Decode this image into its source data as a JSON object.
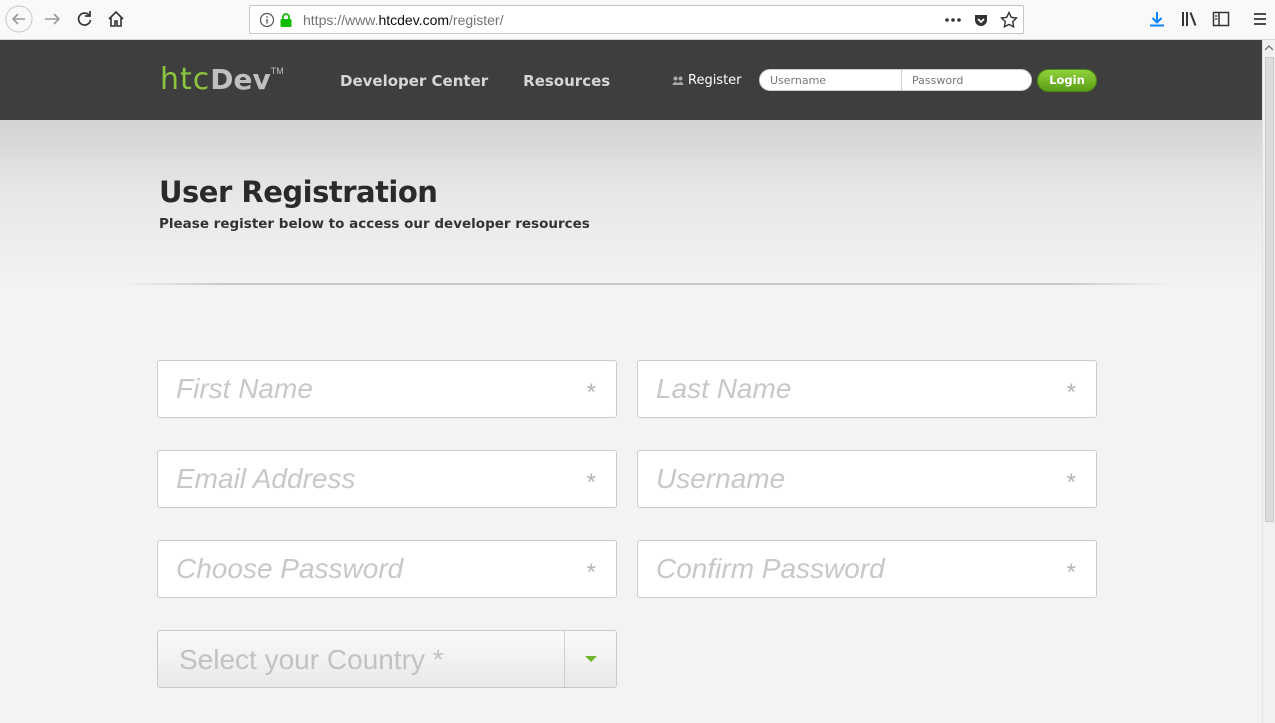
{
  "browser": {
    "url_prefix": "https://www.",
    "url_host": "htcdev.com",
    "url_path": "/register/",
    "icons": [
      "back-icon",
      "forward-icon",
      "reload-icon",
      "home-icon",
      "info-icon",
      "lock-icon",
      "more-icon",
      "pocket-icon",
      "bookmark-star-icon",
      "download-icon",
      "library-icon",
      "sidebar-icon",
      "menu-icon"
    ]
  },
  "header": {
    "logo_htc": "htc",
    "logo_dev": "Dev",
    "logo_tm": "TM",
    "nav": [
      "Developer Center",
      "Resources"
    ],
    "register_label": "Register",
    "username_placeholder": "Username",
    "password_placeholder": "Password",
    "login_label": "Login",
    "bg_color": "#3e3e3e",
    "accent_color": "#8cc43f"
  },
  "hero": {
    "title": "User Registration",
    "subtitle": "Please register below to access our developer resources"
  },
  "form": {
    "first_name": "First Name",
    "last_name": "Last Name",
    "email": "Email Address",
    "username": "Username",
    "choose_password": "Choose Password",
    "confirm_password": "Confirm Password",
    "required_marker": "*",
    "country_select": "Select your Country *"
  }
}
